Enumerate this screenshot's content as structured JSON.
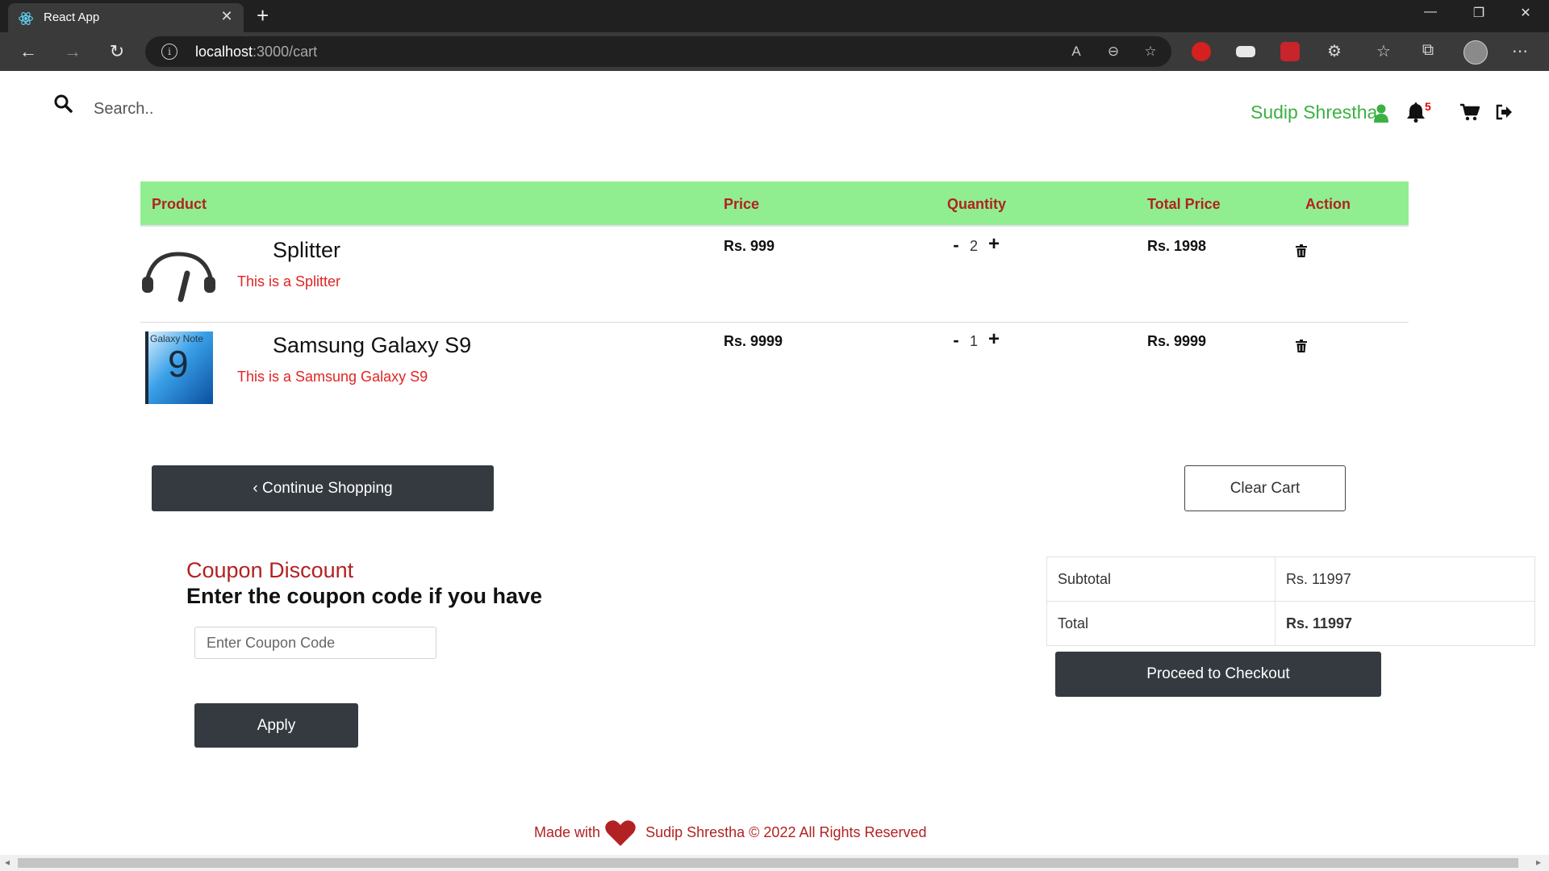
{
  "browser": {
    "tab_title": "React App",
    "tab_close": "✕",
    "new_tab": "+",
    "url_host": "localhost",
    "url_path": ":3000/cart",
    "win_minimize": "—",
    "win_restore": "❐",
    "win_close": "✕"
  },
  "header": {
    "search_placeholder": "Search..",
    "username": "Sudip Shrestha",
    "notification_count": "5"
  },
  "cart": {
    "columns": [
      "Product",
      "Price",
      "Quantity",
      "Total Price",
      "Action"
    ],
    "items": [
      {
        "name": "Splitter",
        "description": "This is a Splitter",
        "price": "Rs. 999",
        "quantity": "2",
        "total": "Rs. 1998",
        "image_icon": "headphone-splitter-image"
      },
      {
        "name": "Samsung Galaxy S9",
        "description": "This is a Samsung Galaxy S9",
        "price": "Rs. 9999",
        "quantity": "1",
        "total": "Rs. 9999",
        "image_icon": "galaxy-note-box-image",
        "image_text": "Galaxy Note",
        "image_number": "9"
      }
    ],
    "minus_symbol": "-",
    "plus_symbol": "+"
  },
  "actions": {
    "continue_label": "Continue Shopping",
    "continue_chevron": "‹",
    "clear_label": "Clear Cart"
  },
  "coupon": {
    "title": "Coupon Discount",
    "subtitle": "Enter the coupon code if you have",
    "placeholder": "Enter Coupon Code",
    "apply_label": "Apply"
  },
  "summary": {
    "subtotal_label": "Subtotal",
    "subtotal_value": "Rs. 11997",
    "total_label": "Total",
    "total_value": "Rs. 11997",
    "checkout_label": "Proceed to Checkout"
  },
  "footer": {
    "made_with": "Made with",
    "credit": "Sudip Shrestha © 2022 All Rights Reserved"
  },
  "colors": {
    "table_header_bg": "#90ee90",
    "accent_red": "#b22222",
    "username_green": "#3cb043",
    "total_blue": "#0000cc",
    "button_dark": "#343a40"
  }
}
